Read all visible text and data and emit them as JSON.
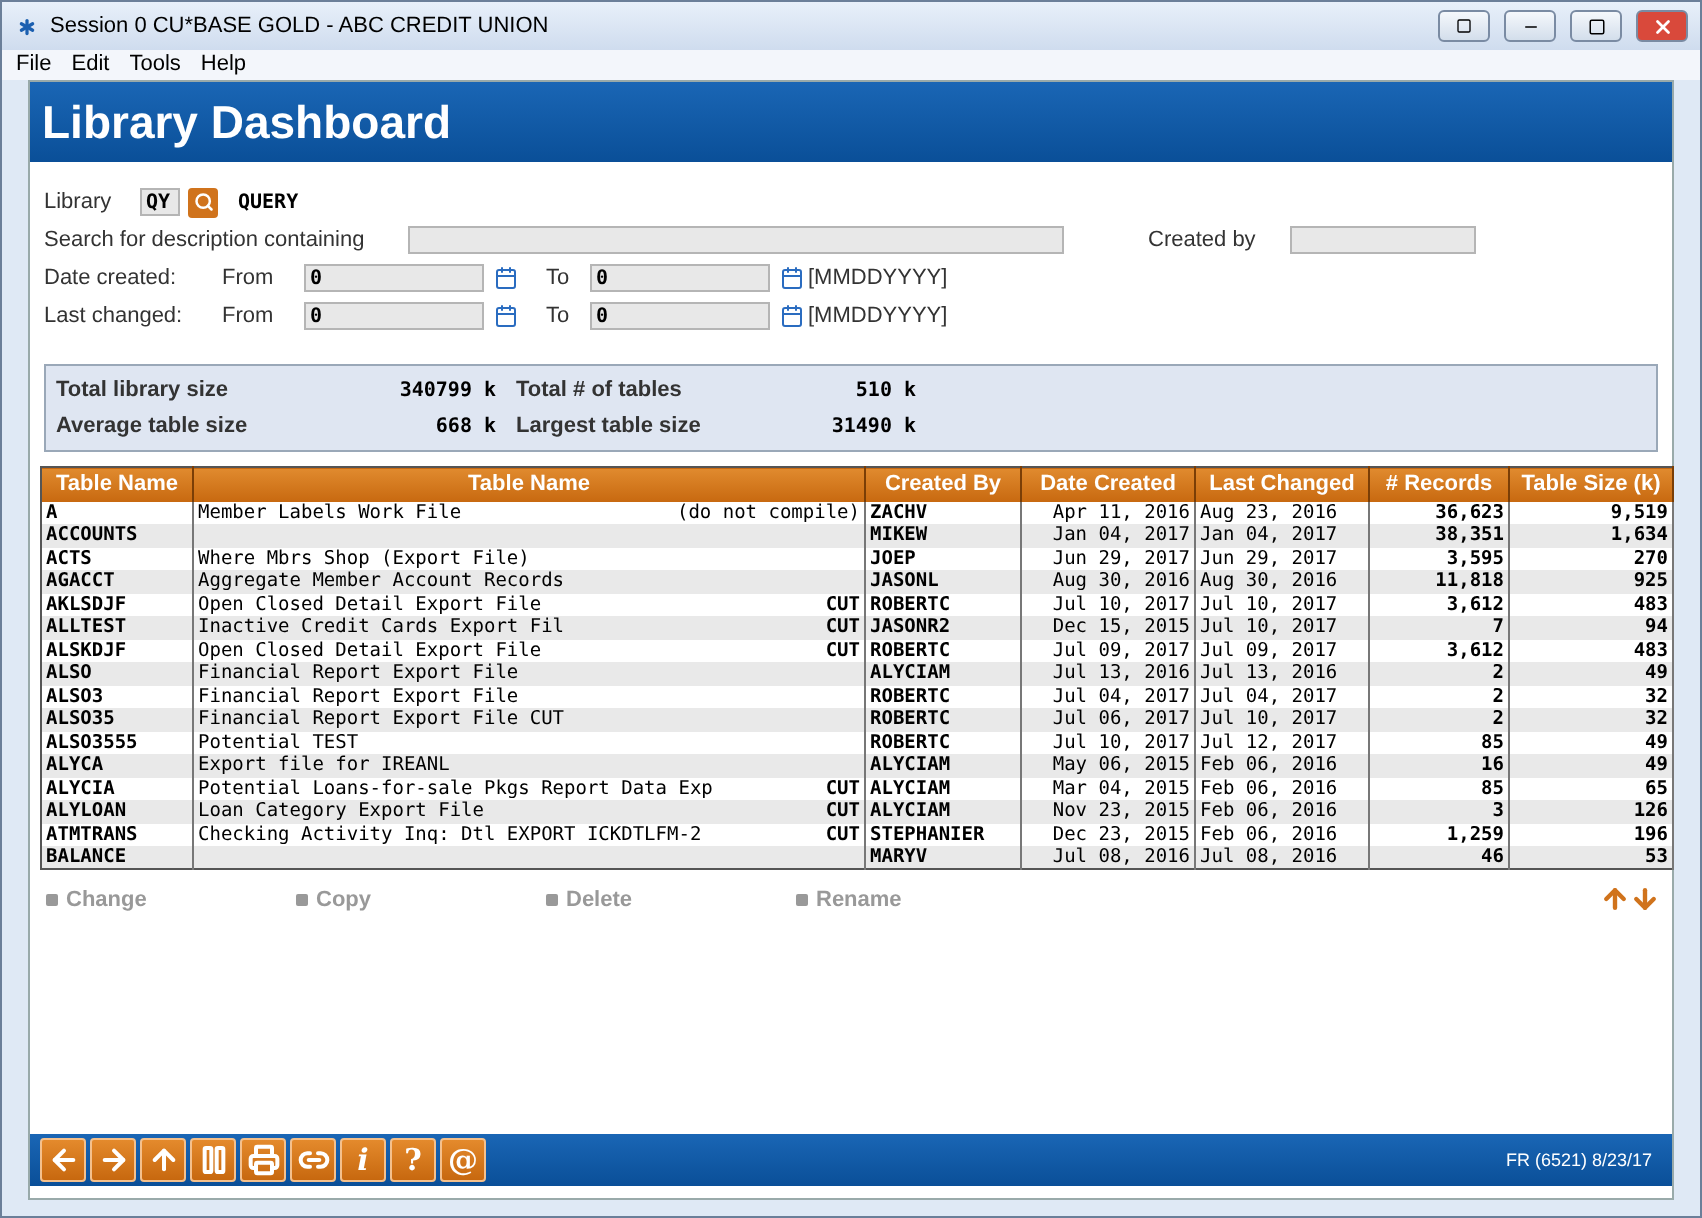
{
  "window": {
    "title": "Session 0 CU*BASE GOLD - ABC CREDIT UNION"
  },
  "menu": [
    "File",
    "Edit",
    "Tools",
    "Help"
  ],
  "header": {
    "title": "Library Dashboard"
  },
  "form": {
    "library_label": "Library",
    "library_value": "QY",
    "library_name": "QUERY",
    "search_label": "Search for description containing",
    "created_by_label": "Created by",
    "date_rows": [
      {
        "label": "Date created:",
        "from_label": "From",
        "from_value": "0",
        "to_label": "To",
        "to_value": "0",
        "format": "[MMDDYYYY]"
      },
      {
        "label": "Last changed:",
        "from_label": "From",
        "from_value": "0",
        "to_label": "To",
        "to_value": "0",
        "format": "[MMDDYYYY]"
      }
    ]
  },
  "summary": [
    {
      "label": "Total library size",
      "value": "340799",
      "unit": "k"
    },
    {
      "label": "Total # of tables",
      "value": "510",
      "unit": "k"
    },
    {
      "label": "Average table size",
      "value": "668",
      "unit": "k"
    },
    {
      "label": "Largest table size",
      "value": "31490",
      "unit": "k"
    }
  ],
  "table": {
    "columns": [
      "Table Name",
      "Table Name",
      "Created By",
      "Date Created",
      "Last Changed",
      "# Records",
      "Table Size (k)"
    ],
    "rows": [
      {
        "name": "A",
        "description": "Member Labels Work File",
        "flag": "(do not compile)",
        "created_by": "ZACHV",
        "date_created": "Apr 11, 2016",
        "last_changed": "Aug 23, 2016",
        "records": "36,623",
        "size": "9,519"
      },
      {
        "name": "ACCOUNTS",
        "created_by": "MIKEW",
        "date_created": "Jan 04, 2017",
        "last_changed": "Jan 04, 2017",
        "records": "38,351",
        "size": "1,634"
      },
      {
        "name": "ACTS",
        "description": "Where Mbrs Shop (Export File)",
        "created_by": "JOEP",
        "date_created": "Jun 29, 2017",
        "last_changed": "Jun 29, 2017",
        "records": "3,595",
        "size": "270"
      },
      {
        "name": "AGACCT",
        "description": "Aggregate Member Account Records",
        "created_by": "JASONL",
        "date_created": "Aug 30, 2016",
        "last_changed": "Aug 30, 2016",
        "records": "11,818",
        "size": "925"
      },
      {
        "name": "AKLSDJF",
        "description": "Open Closed Detail Export File",
        "flag": "CUT",
        "created_by": "ROBERTC",
        "date_created": "Jul 10, 2017",
        "last_changed": "Jul 10, 2017",
        "records": "3,612",
        "size": "483"
      },
      {
        "name": "ALLTEST",
        "description": "Inactive Credit Cards Export Fil",
        "flag": "CUT",
        "created_by": "JASONR2",
        "date_created": "Dec 15, 2015",
        "last_changed": "Jul 10, 2017",
        "records": "7",
        "size": "94"
      },
      {
        "name": "ALSKDJF",
        "description": "Open Closed Detail Export File",
        "flag": "CUT",
        "created_by": "ROBERTC",
        "date_created": "Jul 09, 2017",
        "last_changed": "Jul 09, 2017",
        "records": "3,612",
        "size": "483"
      },
      {
        "name": "ALSO",
        "description": "Financial Report Export File",
        "created_by": "ALYCIAM",
        "date_created": "Jul 13, 2016",
        "last_changed": "Jul 13, 2016",
        "records": "2",
        "size": "49"
      },
      {
        "name": "ALSO3",
        "description": "Financial Report Export File",
        "created_by": "ROBERTC",
        "date_created": "Jul 04, 2017",
        "last_changed": "Jul 04, 2017",
        "records": "2",
        "size": "32"
      },
      {
        "name": "ALSO35",
        "description": "Financial Report Export File CUT",
        "created_by": "ROBERTC",
        "date_created": "Jul 06, 2017",
        "last_changed": "Jul 10, 2017",
        "records": "2",
        "size": "32"
      },
      {
        "name": "ALSO3555",
        "description": "Potential TEST",
        "created_by": "ROBERTC",
        "date_created": "Jul 10, 2017",
        "last_changed": "Jul 12, 2017",
        "records": "85",
        "size": "49"
      },
      {
        "name": "ALYCA",
        "description": "Export file for IREANL",
        "created_by": "ALYCIAM",
        "date_created": "May 06, 2015",
        "last_changed": "Feb 06, 2016",
        "records": "16",
        "size": "49"
      },
      {
        "name": "ALYCIA",
        "description": "Potential Loans-for-sale Pkgs Report Data Exp",
        "flag": "CUT",
        "created_by": "ALYCIAM",
        "date_created": "Mar 04, 2015",
        "last_changed": "Feb 06, 2016",
        "records": "85",
        "size": "65"
      },
      {
        "name": "ALYLOAN",
        "description": "Loan Category Export File",
        "flag": "CUT",
        "created_by": "ALYCIAM",
        "date_created": "Nov 23, 2015",
        "last_changed": "Feb 06, 2016",
        "records": "3",
        "size": "126"
      },
      {
        "name": "ATMTRANS",
        "description": "Checking Activity Inq: Dtl EXPORT ICKDTLFM-2",
        "flag": "CUT",
        "created_by": "STEPHANIER",
        "date_created": "Dec 23, 2015",
        "last_changed": "Feb 06, 2016",
        "records": "1,259",
        "size": "196"
      },
      {
        "name": "BALANCE",
        "created_by": "MARYV",
        "date_created": "Jul 08, 2016",
        "last_changed": "Jul 08, 2016",
        "records": "46",
        "size": "53"
      }
    ]
  },
  "actions": [
    {
      "label": "Change",
      "disabled": true
    },
    {
      "label": "Copy",
      "disabled": true
    },
    {
      "label": "Delete",
      "disabled": true
    },
    {
      "label": "Rename",
      "disabled": true
    }
  ],
  "toolbar": [
    {
      "kind": "back"
    },
    {
      "kind": "forward"
    },
    {
      "kind": "up"
    },
    {
      "kind": "pause"
    },
    {
      "kind": "print"
    },
    {
      "kind": "link"
    },
    {
      "kind": "glyph",
      "label": "i",
      "italic": true
    },
    {
      "kind": "glyph",
      "label": "?"
    },
    {
      "kind": "glyph",
      "label": "@"
    }
  ],
  "status": "FR (6521) 8/23/17"
}
